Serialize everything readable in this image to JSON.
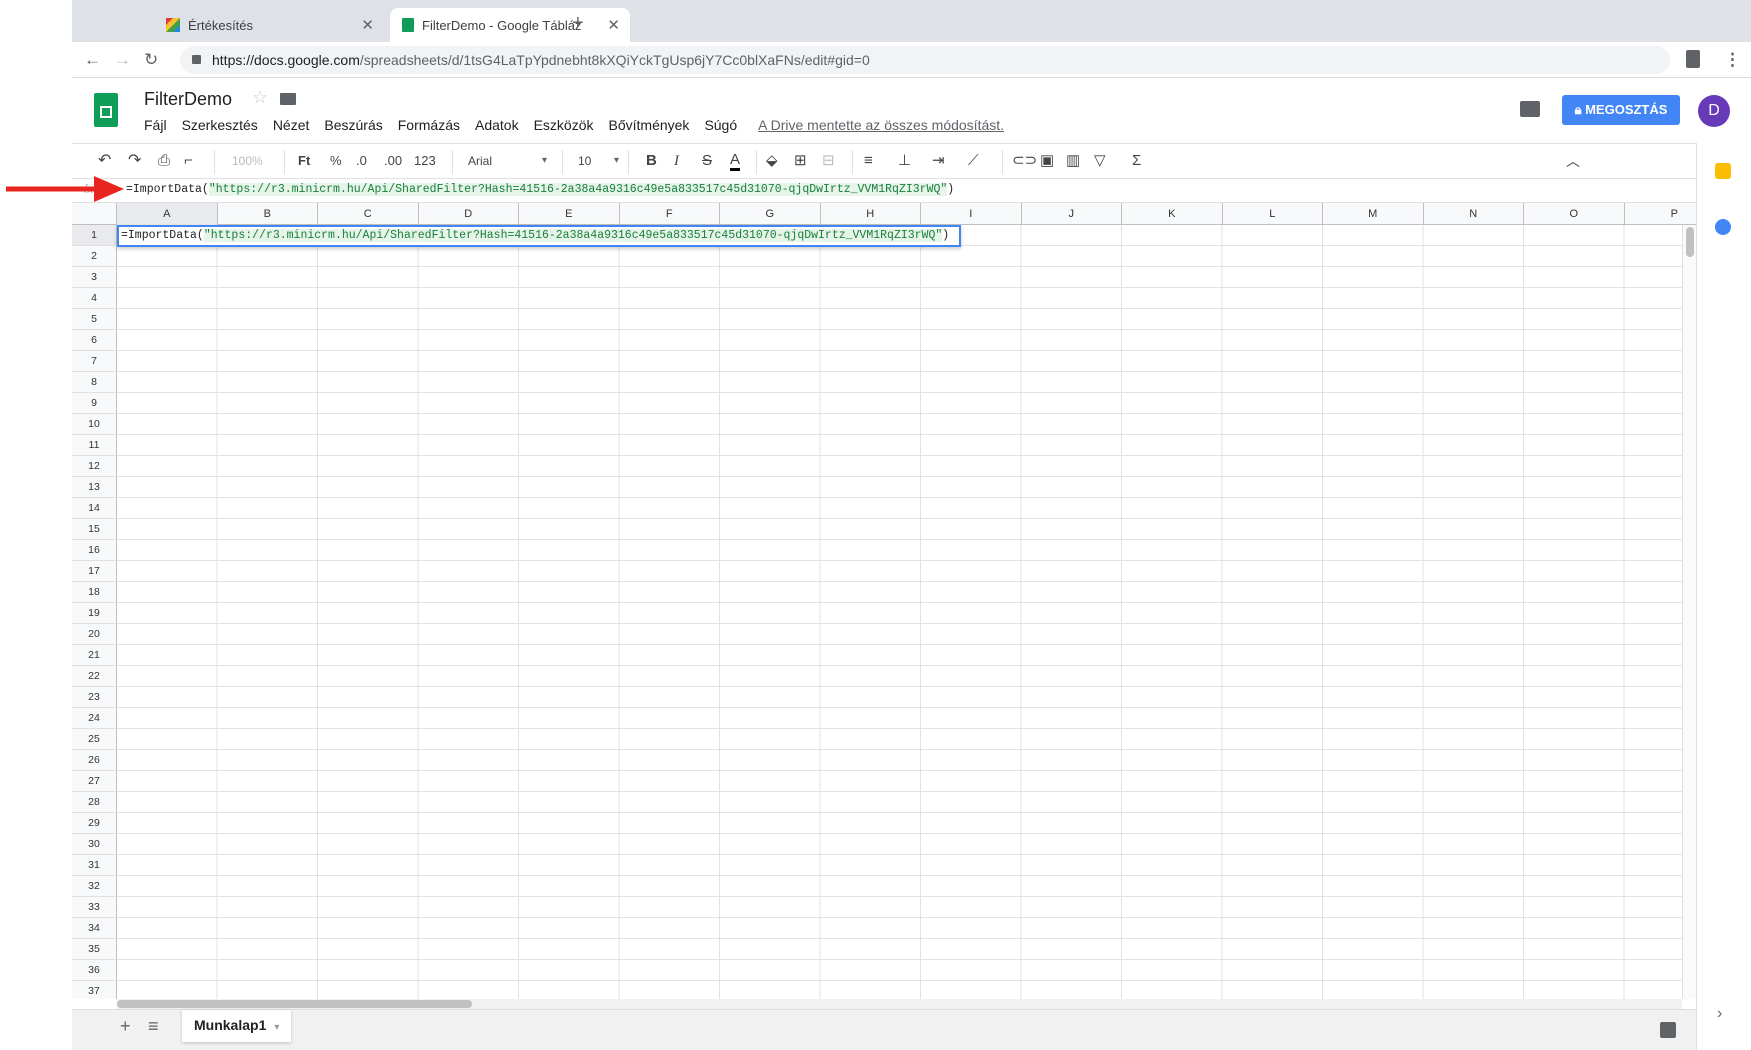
{
  "browser": {
    "tabs": [
      {
        "title": "Értékesítés",
        "close": "✕"
      },
      {
        "title": "FilterDemo - Google Táblázato",
        "close": "✕"
      }
    ],
    "new_tab": "+",
    "url_host": "https://docs.google.com",
    "url_path": "/spreadsheets/d/1tsG4LaTpYpdnebht8kXQiYckTgUsp6jY7Cc0blXaFNs/edit#gid=0"
  },
  "app": {
    "doc_title": "FilterDemo",
    "menu": [
      "Fájl",
      "Szerkesztés",
      "Nézet",
      "Beszúrás",
      "Formázás",
      "Adatok",
      "Eszközök",
      "Bővítmények",
      "Súgó"
    ],
    "saved_message": "A Drive mentette az összes módosítást.",
    "share_label": "MEGOSZTÁS",
    "avatar_letter": "D"
  },
  "toolbar": {
    "zoom": "100%",
    "currency": "Ft",
    "percent": "%",
    "dec_less": ".0",
    "dec_more": ".00",
    "format_more": "123",
    "font": "Arial",
    "font_size": "10",
    "bold": "B",
    "italic": "I",
    "strike": "S",
    "text_color": "A",
    "functions": "Σ"
  },
  "formula": {
    "fn_prefix": "=ImportData(",
    "string_arg": "\"https://r3.minicrm.hu/Api/SharedFilter?Hash=41516-2a38a4a9316c49e5a833517c45d31070-qjqDwIrtz_VVM1RqZI3rWQ\"",
    "fn_suffix": ")"
  },
  "grid": {
    "columns": [
      "A",
      "B",
      "C",
      "D",
      "E",
      "F",
      "G",
      "H",
      "I",
      "J",
      "K",
      "L",
      "M",
      "N",
      "O",
      "P"
    ],
    "rows": [
      "1",
      "2",
      "3",
      "4",
      "5",
      "6",
      "7",
      "8",
      "9",
      "10",
      "11",
      "12",
      "13",
      "14",
      "15",
      "16",
      "17",
      "18",
      "19",
      "20",
      "21",
      "22",
      "23",
      "24",
      "25",
      "26",
      "27",
      "28",
      "29",
      "30",
      "31",
      "32",
      "33",
      "34",
      "35",
      "36",
      "37"
    ]
  },
  "sheet": {
    "add": "+",
    "list": "≡",
    "tab_name": "Munkalap1"
  },
  "colors": {
    "accent": "#4285f4",
    "sheets_green": "#0f9d58",
    "arrow_red": "#e8261f",
    "avatar": "#673ab7"
  }
}
